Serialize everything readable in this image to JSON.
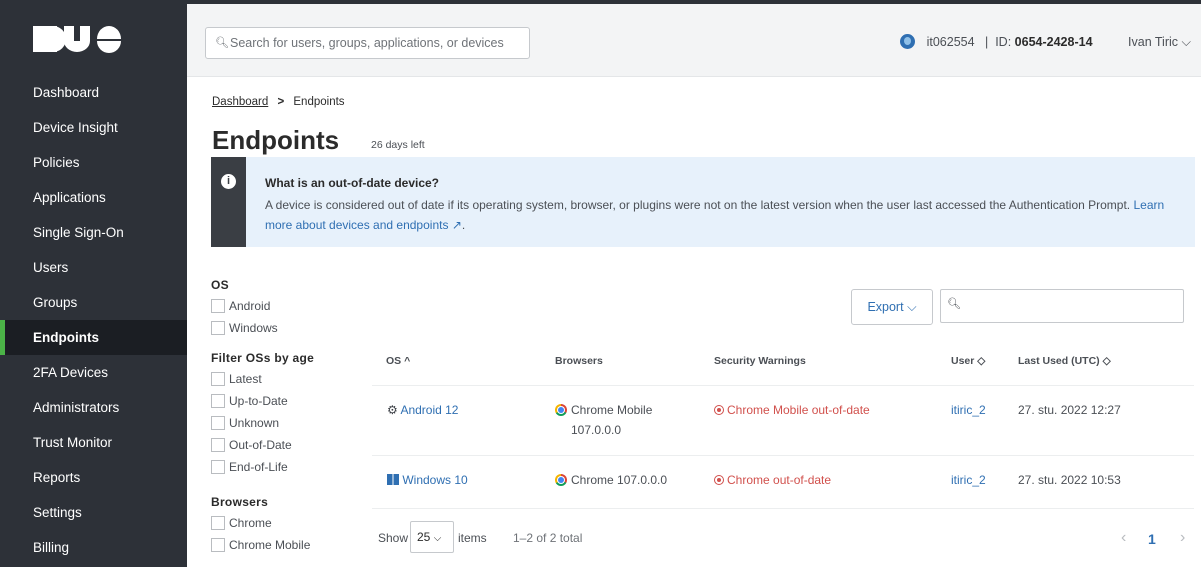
{
  "app": {
    "logo_text": "DUO"
  },
  "sidebar": {
    "items": [
      {
        "label": "Dashboard"
      },
      {
        "label": "Device Insight"
      },
      {
        "label": "Policies"
      },
      {
        "label": "Applications"
      },
      {
        "label": "Single Sign-On"
      },
      {
        "label": "Users"
      },
      {
        "label": "Groups"
      },
      {
        "label": "Endpoints",
        "active": true
      },
      {
        "label": "2FA Devices"
      },
      {
        "label": "Administrators"
      },
      {
        "label": "Trust Monitor"
      },
      {
        "label": "Reports"
      },
      {
        "label": "Settings"
      },
      {
        "label": "Billing"
      }
    ]
  },
  "header": {
    "search_placeholder": "Search for users, groups, applications, or devices",
    "account": "it062554",
    "id_label": "ID:",
    "id_value": "0654-2428-14",
    "user": "Ivan Tiric"
  },
  "breadcrumb": {
    "root": "Dashboard",
    "separator": ">",
    "current": "Endpoints"
  },
  "page": {
    "title": "Endpoints",
    "trial": "26 days left"
  },
  "notice": {
    "heading": "What is an out-of-date device?",
    "text": "A device is considered out of date if its operating system, browser, or plugins were not on the latest version when the user last accessed the Authentication Prompt.",
    "link": "Learn more about devices and endpoints"
  },
  "filters": {
    "os": {
      "title": "OS",
      "options": [
        "Android",
        "Windows"
      ]
    },
    "age": {
      "title": "Filter OSs by age",
      "options": [
        "Latest",
        "Up-to-Date",
        "Unknown",
        "Out-of-Date",
        "End-of-Life"
      ]
    },
    "browsers": {
      "title": "Browsers",
      "options": [
        "Chrome",
        "Chrome Mobile"
      ]
    }
  },
  "toolbar": {
    "export_label": "Export"
  },
  "table": {
    "columns": [
      "OS",
      "Browsers",
      "Security Warnings",
      "User",
      "Last Used (UTC)"
    ],
    "rows": [
      {
        "os": "Android 12",
        "browser_line1": "Chrome Mobile",
        "browser_line2": "107.0.0.0",
        "warning": "Chrome Mobile out-of-date",
        "user": "itiric_2",
        "last_used": "27. stu. 2022 12:27"
      },
      {
        "os": "Windows 10",
        "browser_line1": "Chrome 107.0.0.0",
        "browser_line2": "",
        "warning": "Chrome out-of-date",
        "user": "itiric_2",
        "last_used": "27. stu. 2022 10:53"
      }
    ]
  },
  "pagination": {
    "show_label": "Show",
    "page_size": "25",
    "items_label": "items",
    "total": "1–2 of 2 total",
    "current_page": "1"
  },
  "colors": {
    "sidebar_bg": "#2d3138",
    "active_accent": "#4bb347",
    "link": "#2f6fb2",
    "warning": "#d1504c"
  }
}
